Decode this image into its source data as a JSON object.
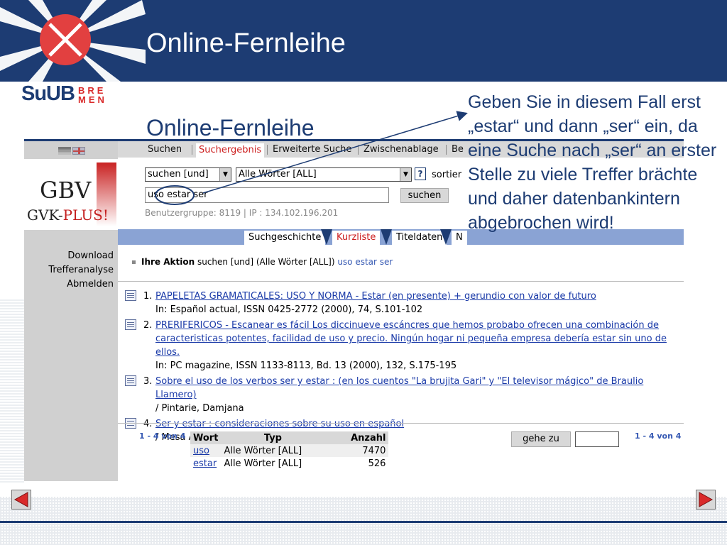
{
  "slide": {
    "title": "Online-Fernleihe",
    "subtitle": "Online-Fernleihe",
    "logo": {
      "su": "SuUB",
      "bre": "BRE",
      "men": "MEN"
    },
    "annotation": "Geben Sie in diesem Fall erst „estar“ und dann „ser“ ein, da eine Suche nach „ser“ an erster Stelle zu viele Treffer brächte und daher datenbankintern abgebrochen wird!",
    "colors": {
      "brand_blue": "#1d3c73",
      "accent_red": "#d92a2a"
    }
  },
  "app": {
    "menu": {
      "items": [
        "Suchen",
        "Suchergebnis",
        "Erweiterte Suche",
        "Zwischenablage",
        "Be"
      ],
      "active": "Suchergebnis"
    },
    "logo": {
      "gbv": "GBV",
      "gvk": "GVK-",
      "plus": "PLUS!"
    },
    "search": {
      "mode_select": "suchen [und]",
      "field_select": "Alle Wörter [ALL]",
      "help": "?",
      "sort_label": "sortier",
      "query": "uso estar ser",
      "button": "suchen",
      "usergroup": "Benutzergruppe: 8119 | IP : 134.102.196.201"
    },
    "tabs": [
      "Suchgeschichte",
      "Kurzliste",
      "Titeldaten",
      "N"
    ],
    "active_tab": "Kurzliste",
    "sidebar": [
      "Download",
      "Trefferanalyse",
      "Abmelden"
    ],
    "action": {
      "label": "Ihre Aktion",
      "text": " suchen [und] (Alle Wörter [ALL]) ",
      "query": "uso estar ser"
    },
    "results": [
      {
        "num": "1.",
        "title": "PAPELETAS GRAMATICALES: USO Y NORMA - Estar (en presente) + gerundio con valor de futuro",
        "detail": "In: Español actual, ISSN 0425-2772 (2000), 74, S.101-102"
      },
      {
        "num": "2.",
        "title": "PRERIFERICOS - Escanear es fácil Los diccinueve escáncres que hemos probabo ofrecen una combinación de caracteristicas potentes, facilidad de uso y precio. Ningún hogar ni pequeña empresa debería estar sin uno de ellos.",
        "detail": "In: PC magazine, ISSN 1133-8113, Bd. 13 (2000), 132, S.175-195"
      },
      {
        "num": "3.",
        "title": "Sobre el uso de los verbos ser y estar : (en los cuentos \"La brujita Gari\" y \"El televisor mágico\" de Braulio Llamero)",
        "detail": "/ Pintarie, Damjana"
      },
      {
        "num": "4.",
        "title": "Ser y estar : consideraciones sobre su uso en español",
        "detail": "/ Mesa Alonso, Milvia"
      }
    ],
    "pager": {
      "left": "1 - 4 von 4",
      "right": "1 - 4 von 4",
      "goto": "gehe zu"
    },
    "word_table": {
      "headers": [
        "Wort",
        "Typ",
        "Anzahl"
      ],
      "rows": [
        {
          "word": "uso",
          "type": "Alle Wörter [ALL]",
          "count": "7470"
        },
        {
          "word": "estar",
          "type": "Alle Wörter [ALL]",
          "count": "526"
        }
      ]
    }
  },
  "nav": {
    "prev_icon": "triangle-left-icon",
    "next_icon": "triangle-right-icon"
  }
}
